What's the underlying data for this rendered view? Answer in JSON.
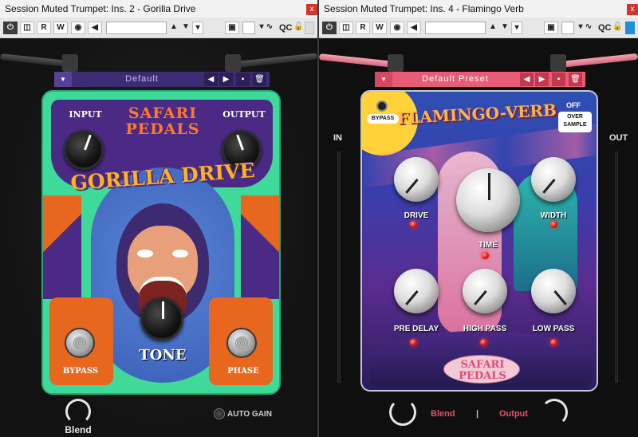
{
  "left": {
    "title": "Session Muted Trumpet: Ins. 2 - Gorilla Drive",
    "close": "x",
    "toolbar": {
      "r": "R",
      "w": "W",
      "qc": "QC"
    },
    "preset": {
      "name": "Default"
    },
    "pedal": {
      "brand_line1": "SAFARI",
      "brand_line2": "PEDALS",
      "name": "GORILLA DRIVE",
      "input_label": "INPUT",
      "output_label": "OUTPUT",
      "tone_label": "TONE",
      "bypass_label": "BYPASS",
      "phase_label": "PHASE"
    },
    "footer": {
      "blend": "Blend",
      "auto_gain": "AUTO GAIN"
    },
    "colors": {
      "pedal": "#3fd99a",
      "purple": "#4b2a86",
      "orange": "#e8671f"
    }
  },
  "right": {
    "title": "Session Muted Trumpet: Ins. 4 - Flamingo Verb",
    "close": "x",
    "toolbar": {
      "r": "R",
      "w": "W",
      "qc": "QC"
    },
    "preset": {
      "name": "Default Preset"
    },
    "pedal": {
      "name": "FLAMINGO-VERB",
      "bypass_label": "BYPASS",
      "off_label": "OFF",
      "oversample_line1": "OVER",
      "oversample_line2": "SAMPLE",
      "drive_label": "DRIVE",
      "time_label": "TIME",
      "width_label": "WIDTH",
      "predelay_label": "PRE DELAY",
      "highpass_label": "HIGH PASS",
      "lowpass_label": "LOW PASS",
      "brand_line1": "SAFARI",
      "brand_line2": "PEDALS"
    },
    "in_label": "IN",
    "out_label": "OUT",
    "footer": {
      "blend": "Blend",
      "separator": "|",
      "output": "Output"
    },
    "colors": {
      "accent": "#e7506a",
      "preset_bg": "#e65d75"
    }
  }
}
